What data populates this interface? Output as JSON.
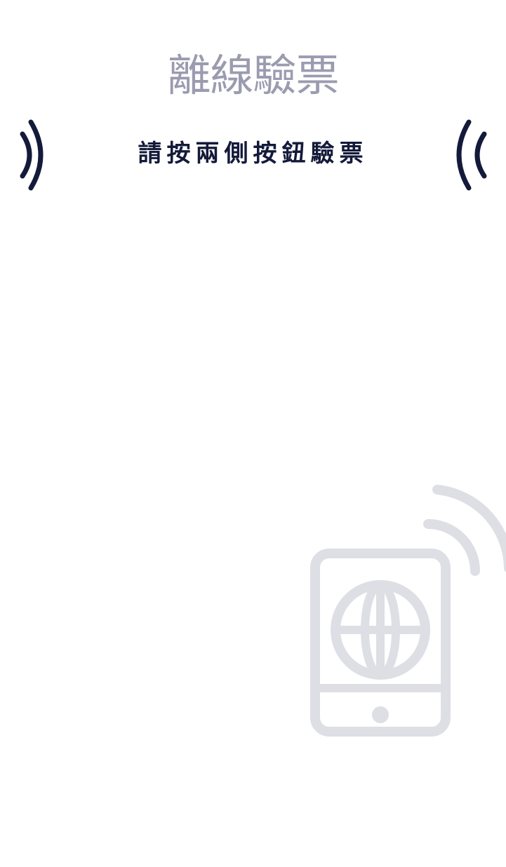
{
  "screen": {
    "title": "離線驗票",
    "instruction": "請按兩側按鈕驗票"
  },
  "icons": {
    "left_side": "signal-waves-icon",
    "right_side": "signal-waves-icon",
    "illustration": "phone-globe-nfc-icon"
  },
  "colors": {
    "title": "#9b9bb0",
    "instruction": "#141a3a",
    "wave": "#141a3a",
    "illustration": "#dedfe5"
  }
}
